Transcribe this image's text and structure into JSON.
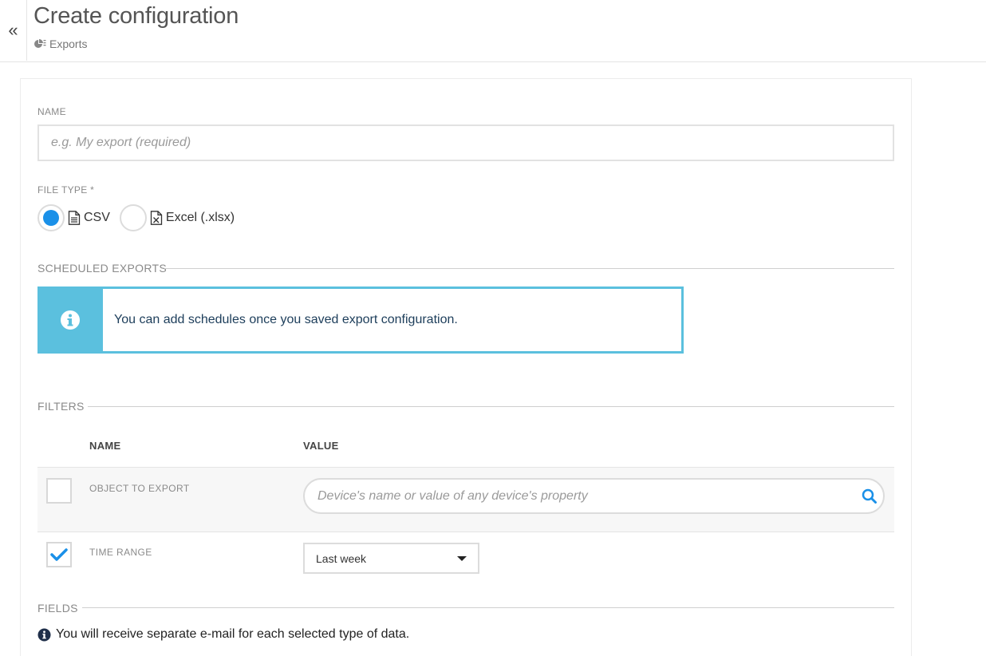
{
  "header": {
    "title": "Create configuration",
    "breadcrumb": "Exports",
    "collapse_glyph": "«"
  },
  "form": {
    "name_label": "NAME",
    "name_placeholder": "e.g. My export (required)",
    "file_type_label": "FILE TYPE *",
    "file_types": [
      {
        "label": "CSV",
        "selected": true,
        "icon": "csv-file-icon"
      },
      {
        "label": "Excel (.xlsx)",
        "selected": false,
        "icon": "excel-file-icon"
      }
    ],
    "scheduled_label": "SCHEDULED EXPORTS",
    "scheduled_info": "You can add schedules once you saved export configuration.",
    "filters_label": "FILTERS",
    "filters_columns": {
      "name": "NAME",
      "value": "VALUE"
    },
    "filters": [
      {
        "name": "OBJECT TO EXPORT",
        "checked": false,
        "placeholder": "Device's name or value of any device's property"
      },
      {
        "name": "TIME RANGE",
        "checked": true,
        "value": "Last week"
      }
    ],
    "fields_label": "FIELDS",
    "fields_info": "You will receive separate e-mail for each selected type of data."
  },
  "colors": {
    "accent": "#1a90e8",
    "info": "#5bc0de"
  }
}
